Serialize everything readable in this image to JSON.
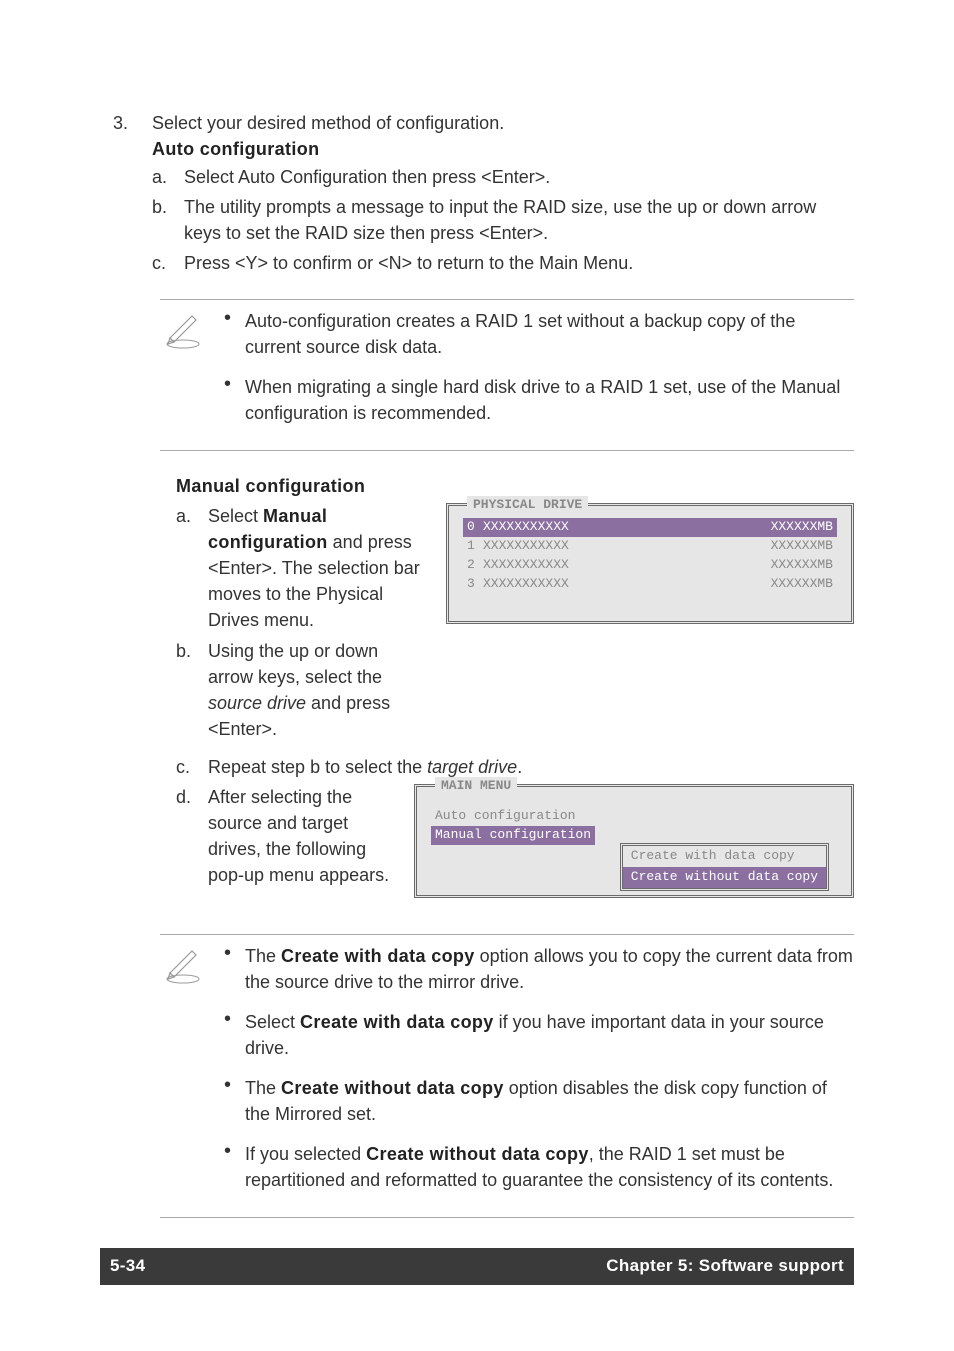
{
  "step3": {
    "number": "3.",
    "intro": "Select your desired method of configuration.",
    "auto_title": "Auto configuration",
    "auto": {
      "a_letter": "a.",
      "a_text": "Select Auto Configuration then press <Enter>.",
      "b_letter": "b.",
      "b_text": "The utility prompts a message to input the RAID size, use the up or down arrow keys to set the RAID size then press <Enter>.",
      "c_letter": "c.",
      "c_text": "Press <Y> to confirm or <N> to return to the Main Menu."
    }
  },
  "note1": {
    "b1": "Auto-configuration creates a RAID 1 set without a backup copy of the current source disk data.",
    "b2": "When migrating a single hard disk drive to a RAID 1 set, use of the Manual configuration is recommended."
  },
  "manual": {
    "title": "Manual configuration",
    "a_letter": "a.",
    "a_pre": "Select ",
    "a_bold": "Manual configuration",
    "a_post": " and press <Enter>. The selection bar moves to the Physical Drives menu.",
    "b_letter": "b.",
    "b_pre": "Using the up or down arrow keys, select the ",
    "b_italic": "source drive",
    "b_post": " and press <Enter>.",
    "c_letter": "c.",
    "c_pre": "Repeat step b to select the ",
    "c_italic": "target drive",
    "c_post": ".",
    "d_letter": "d.",
    "d_text": "After selecting the source and target drives, the following pop-up menu appears."
  },
  "panel_drives": {
    "legend": "PHYSICAL DRIVE",
    "rows": [
      {
        "idx": "0",
        "name": "XXXXXXXXXXX",
        "size": "XXXXXXMB"
      },
      {
        "idx": "1",
        "name": "XXXXXXXXXXX",
        "size": "XXXXXXMB"
      },
      {
        "idx": "2",
        "name": "XXXXXXXXXXX",
        "size": "XXXXXXMB"
      },
      {
        "idx": "3",
        "name": "XXXXXXXXXXX",
        "size": "XXXXXXMB"
      }
    ]
  },
  "panel_main": {
    "legend": "MAIN MENU",
    "item1": "Auto configuration",
    "item2": "Manual configuration",
    "popup1": "Create with data copy",
    "popup2": "Create without data copy"
  },
  "note2": {
    "b1_pre": "The ",
    "b1_bold": "Create with data copy",
    "b1_post": " option allows you to copy the current data from the source drive to the mirror drive.",
    "b2_pre": "Select ",
    "b2_bold": "Create with data copy",
    "b2_post": " if you have important data in your source drive.",
    "b3_pre": "The ",
    "b3_bold": "Create without data copy",
    "b3_post": " option disables the disk copy function of the Mirrored set.",
    "b4_pre": "If you selected ",
    "b4_bold": "Create without data copy",
    "b4_post": ", the RAID 1 set must be repartitioned and reformatted to guarantee the consistency of its contents."
  },
  "footer": {
    "left": "5-34",
    "right": "Chapter 5: Software support"
  }
}
